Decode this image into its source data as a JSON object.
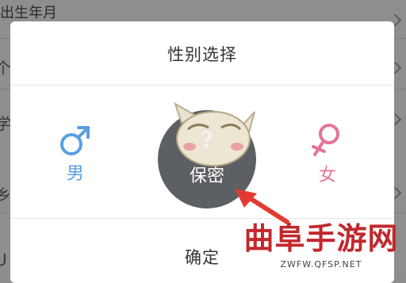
{
  "background": {
    "row_label": "出生年月",
    "stub_labels": [
      "个",
      "学",
      "乡",
      "U"
    ]
  },
  "dialog": {
    "title": "性别选择",
    "options": {
      "male": {
        "label": "男",
        "icon": "male-symbol-icon",
        "color": "#5a9fe0"
      },
      "secret": {
        "label": "保密",
        "icon": "question-mark-icon",
        "selected": true
      },
      "female": {
        "label": "女",
        "icon": "female-symbol-icon",
        "color": "#e6739a"
      }
    },
    "secret_symbol": "?",
    "confirm_label": "确定"
  },
  "watermark": {
    "text": "曲阜手游网",
    "url": "ZWFW.QFSP.NET"
  },
  "colors": {
    "overlay": "#8e8e8e",
    "arrow": "#e23a32",
    "watermark": "#c1282e"
  }
}
